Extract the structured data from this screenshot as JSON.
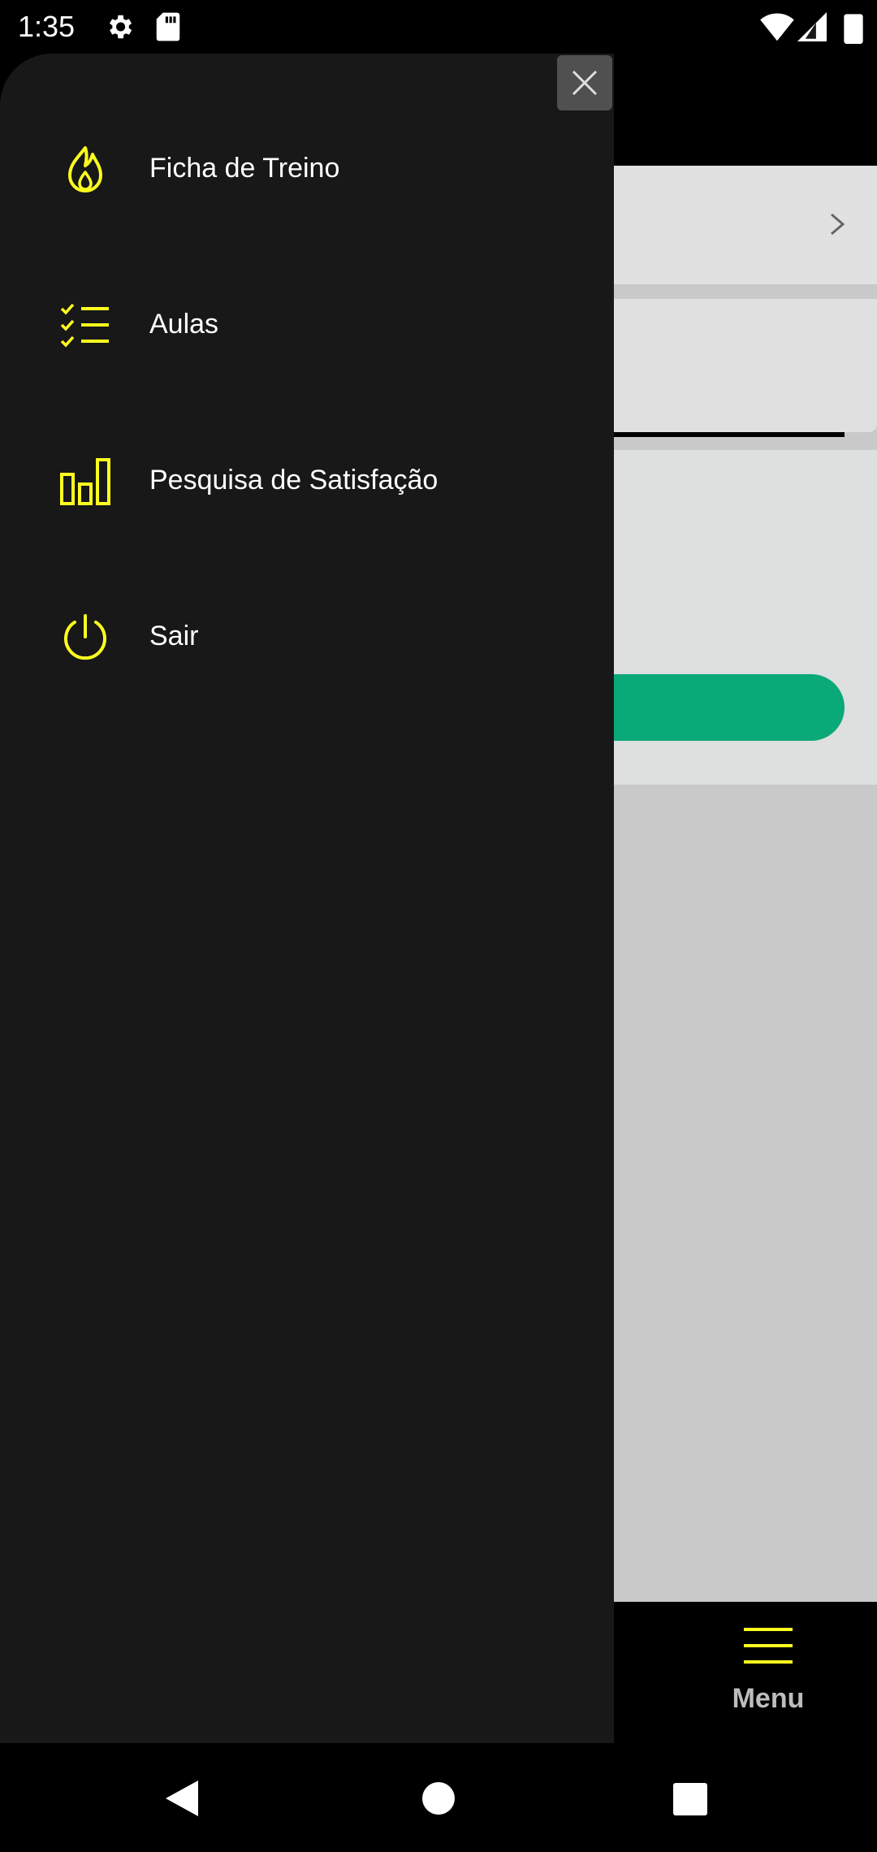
{
  "status_bar": {
    "time": "1:35",
    "icons": [
      "gear-icon",
      "sd-card-icon",
      "wifi-icon",
      "signal-icon",
      "battery-icon"
    ]
  },
  "drawer": {
    "close_icon": "close-icon",
    "items": [
      {
        "label": "Ficha de Treino",
        "icon": "flame-icon"
      },
      {
        "label": "Aulas",
        "icon": "checklist-icon"
      },
      {
        "label": "Pesquisa de Satisfação",
        "icon": "bar-chart-icon"
      },
      {
        "label": "Sair",
        "icon": "power-icon"
      }
    ]
  },
  "bottom_nav": {
    "menu_label": "Menu",
    "menu_icon": "hamburger-icon"
  },
  "nav_bar": {
    "icons": [
      "back-icon",
      "home-icon",
      "recents-icon"
    ]
  },
  "colors": {
    "accent": "#FFFF1F",
    "drawer_bg": "#181818",
    "button_green": "#0AA978"
  }
}
